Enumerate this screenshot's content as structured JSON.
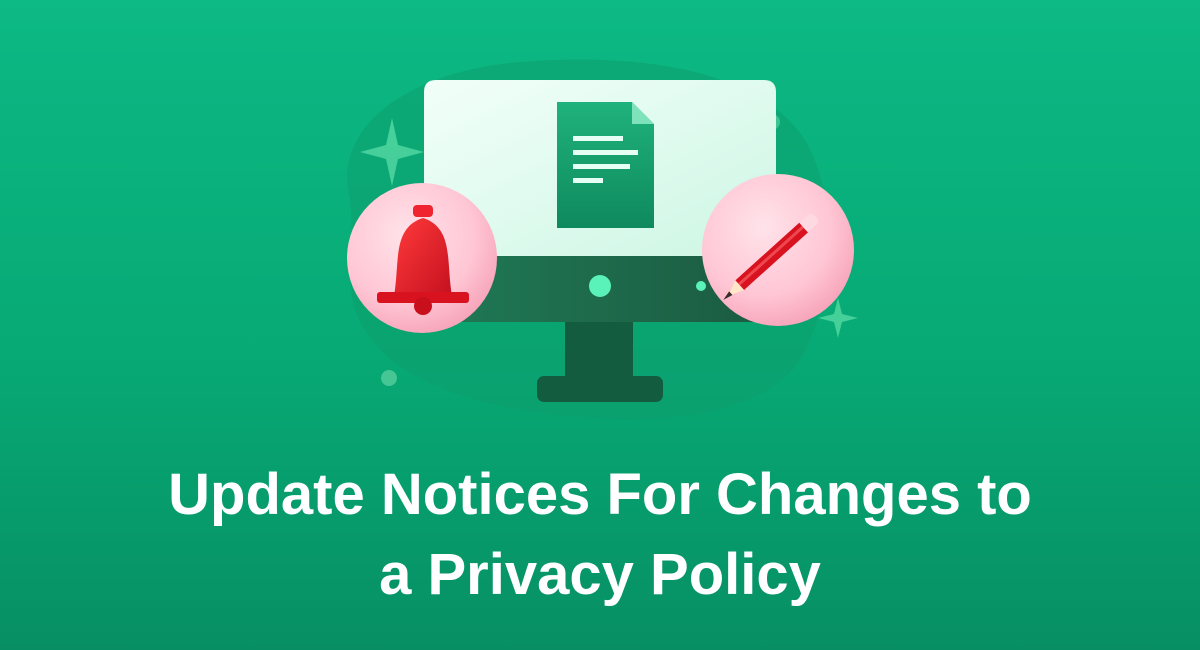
{
  "page": {
    "background_color": "#0bb480",
    "accent_color": "#5af2b8",
    "alert_color": "#e51e2c"
  },
  "illustration": {
    "icons": [
      "monitor-icon",
      "document-icon",
      "bell-icon",
      "pencil-icon",
      "sparkle-icon"
    ]
  },
  "headline": {
    "line1": "Update Notices For Changes to",
    "line2": "a Privacy Policy"
  }
}
